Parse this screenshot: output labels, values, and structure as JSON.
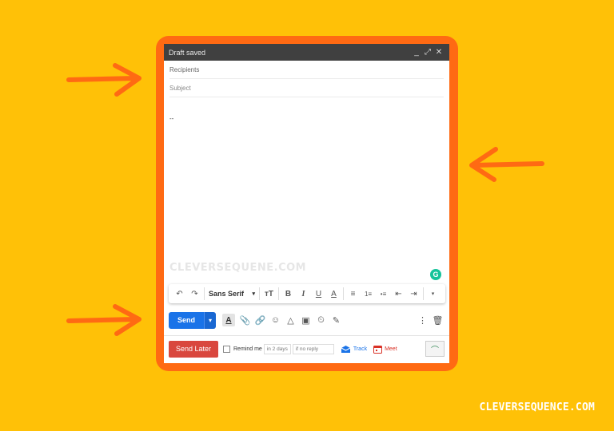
{
  "compose": {
    "title": "Draft saved",
    "controls": {
      "minimize": "_",
      "expand": "⤢",
      "close": "✕"
    },
    "recipients_placeholder": "Recipients",
    "subject_placeholder": "Subject",
    "signature": "--",
    "watermark": "CLEVERSEQUENE.COM"
  },
  "format_toolbar": {
    "undo": "↶",
    "redo": "↷",
    "font": "Sans Serif",
    "font_caret": "▾",
    "size": "ᴛT",
    "bold": "B",
    "italic": "I",
    "underline": "U",
    "text_color": "A",
    "align": "≡",
    "numbered": "1≡",
    "bulleted": "•≡",
    "indent_less": "⇤",
    "indent_more": "⇥",
    "more": "▾"
  },
  "actions": {
    "send": "Send",
    "send_more": "▾",
    "text_color": "A",
    "attach": "📎",
    "link": "🔗",
    "emoji": "☺",
    "drive": "△",
    "photo": "▣",
    "confidential": "⏲",
    "signature": "✎",
    "more": "⋮",
    "delete": "🗑"
  },
  "bottom": {
    "send_later": "Send Later",
    "remind_me": "Remind me",
    "days": "in 2 days",
    "condition": "if no reply",
    "track": "Track",
    "meet": "Meet"
  },
  "site": "CLEVERSEQUENCE.COM",
  "colors": {
    "background": "#FFC107",
    "frame": "#FF6A13",
    "send": "#1A73E8",
    "send_later": "#D9473E"
  }
}
